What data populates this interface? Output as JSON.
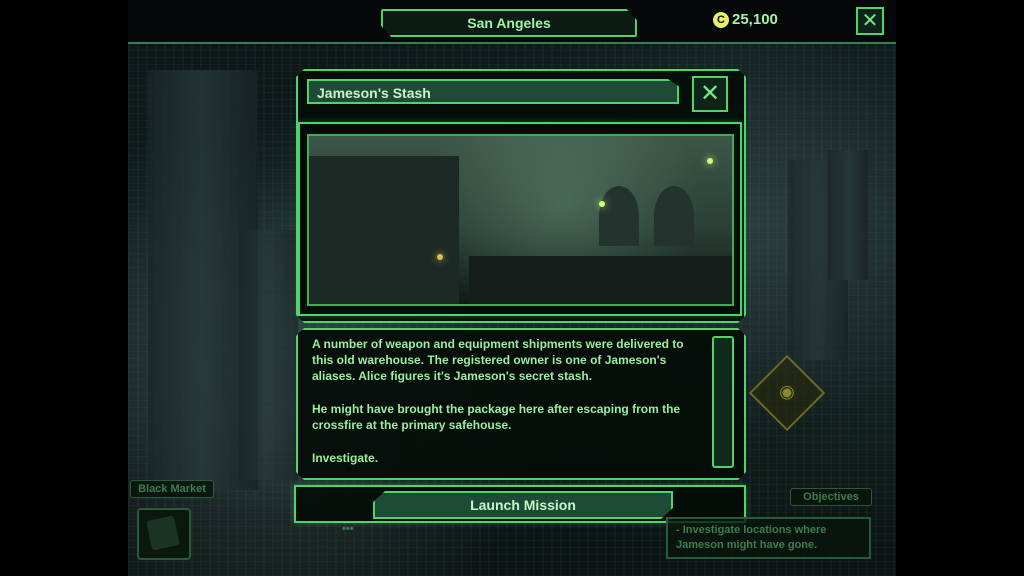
{
  "topbar": {
    "location": "San Angeles",
    "credits": "25,100",
    "credit_icon": "C"
  },
  "mission": {
    "title": "Jameson's Stash",
    "description": [
      "A number of weapon and equipment shipments were delivered to this old warehouse. The registered owner is one of Jameson's aliases. Alice figures it's Jameson's secret stash.",
      "He might have brought the package here after escaping from the crossfire at the primary safehouse.",
      "Investigate."
    ],
    "launch_label": "Launch Mission"
  },
  "side": {
    "black_market_label": "Black Market",
    "objectives_label": "Objectives",
    "objectives_text": "- Investigate locations where Jameson might have gone.",
    "partial_label": "•••"
  },
  "icons": {
    "close": "close-icon",
    "eye": "eye-icon"
  },
  "colors": {
    "accent": "#4fd46a",
    "text": "#9bef9f",
    "credit": "#e8f06a"
  }
}
